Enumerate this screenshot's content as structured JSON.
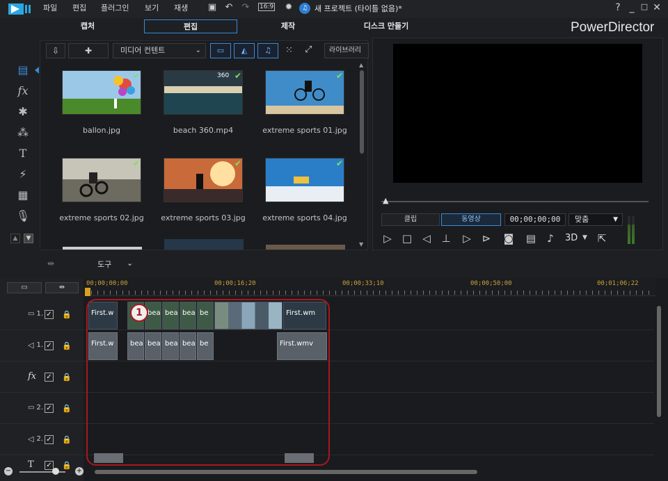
{
  "menu": [
    "파일",
    "편집",
    "플러그인",
    "보기",
    "재생"
  ],
  "toolbar": {
    "aspect": "16:9",
    "project_title": "새 프로젝트 (타이틀 없음)*"
  },
  "window_controls": [
    "?",
    "_",
    "□",
    "✕"
  ],
  "modes": [
    {
      "label": "캡처",
      "active": false
    },
    {
      "label": "편집",
      "active": true
    },
    {
      "label": "제작",
      "active": false
    },
    {
      "label": "디스크 만들기",
      "active": false
    }
  ],
  "brand": "PowerDirector",
  "library": {
    "content_select": "미디어 컨텐트",
    "library_button": "라이브러리",
    "items": [
      {
        "label": "ballon.jpg",
        "badge": ""
      },
      {
        "label": "beach 360.mp4",
        "badge": "360"
      },
      {
        "label": "extreme sports 01.jpg",
        "badge": ""
      },
      {
        "label": "extreme sports 02.jpg",
        "badge": ""
      },
      {
        "label": "extreme sports 03.jpg",
        "badge": ""
      },
      {
        "label": "extreme sports 04.jpg",
        "badge": ""
      }
    ]
  },
  "preview": {
    "tabs": [
      {
        "label": "클립",
        "active": false
      },
      {
        "label": "동영상",
        "active": true
      }
    ],
    "timecode": "00;00;00;00",
    "fit": "맞춤",
    "mode_3d": "3D"
  },
  "tools": {
    "label": "도구"
  },
  "ruler": [
    "00;00;00;00",
    "00;00;16;20",
    "00;00;33;10",
    "00;00;50;00",
    "00;01;06;22"
  ],
  "tracks": [
    {
      "label": "1.",
      "kind": "video"
    },
    {
      "label": "1.",
      "kind": "audio"
    },
    {
      "label": "fx",
      "kind": "fx"
    },
    {
      "label": "2.",
      "kind": "video"
    },
    {
      "label": "2.",
      "kind": "audio"
    },
    {
      "label": "T",
      "kind": "title"
    }
  ],
  "clips": {
    "video": [
      {
        "label": "First.w"
      },
      {
        "label": "bea"
      },
      {
        "label": "bea"
      },
      {
        "label": "bea"
      },
      {
        "label": "bea"
      },
      {
        "label": "be"
      },
      {
        "label": "First.wm"
      }
    ],
    "audio": [
      {
        "label": "First.w"
      },
      {
        "label": "bea"
      },
      {
        "label": "bea"
      },
      {
        "label": "bea"
      },
      {
        "label": "bea"
      },
      {
        "label": "be"
      },
      {
        "label": "First.wmv"
      }
    ]
  },
  "annotation": {
    "badge": "1"
  },
  "colors": {
    "accent": "#3b89d8",
    "annotation": "#a8181e",
    "ruler": "#caa23a"
  }
}
